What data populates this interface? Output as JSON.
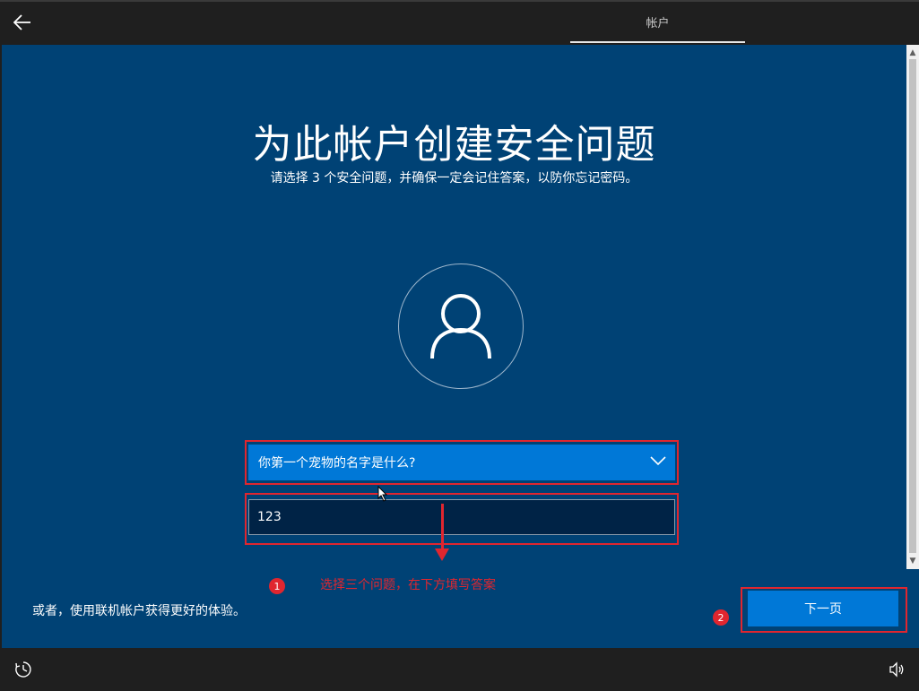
{
  "header": {
    "tab_label": "帐户"
  },
  "main": {
    "title": "为此帐户创建安全问题",
    "subtitle": "请选择 3 个安全问题，并确保一定会记住答案，以防你忘记密码。",
    "question": {
      "selected": "你第一个宠物的名字是什么?"
    },
    "answer": {
      "value": "123"
    },
    "online_account_link": "或者，使用联机帐户获得更好的体验。",
    "next_button": "下一页"
  },
  "annotations": {
    "badge_1": "1",
    "badge_2": "2",
    "note": "选择三个问题，在下方填写答案"
  },
  "colors": {
    "background": "#004275",
    "accent": "#0078d7",
    "annotation_red": "#e0262f"
  },
  "icons": {
    "back": "back-arrow-icon",
    "avatar": "user-icon",
    "dropdown": "chevron-down-icon",
    "ease_of_access": "ease-of-access-icon",
    "volume": "volume-icon"
  }
}
